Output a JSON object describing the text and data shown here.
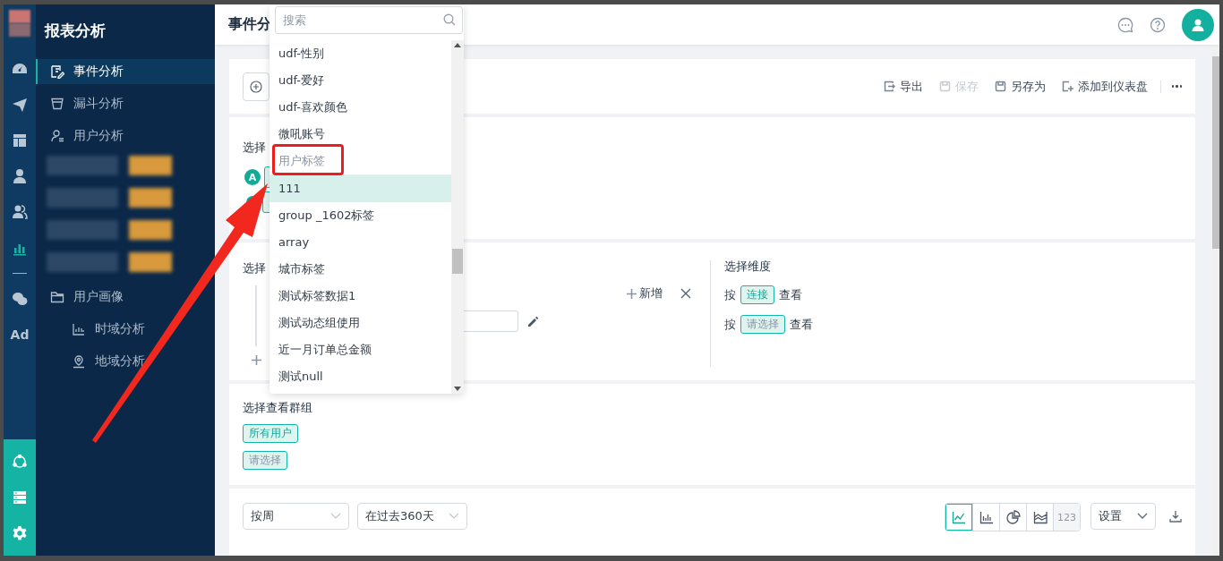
{
  "rail": {
    "items": [
      {
        "selected": false
      },
      {
        "selected": false
      },
      {
        "selected": false
      },
      {
        "selected": false
      },
      {
        "selected": false
      },
      {
        "selected": true
      },
      {
        "selected": false
      }
    ],
    "ad_label": "Ad",
    "bottom_items": [
      {
        "selected": false
      },
      {
        "selected": false
      },
      {
        "selected": false
      }
    ]
  },
  "sidebar": {
    "title": "报表分析",
    "items": [
      {
        "kind": "link",
        "label": "事件分析",
        "selected": true
      },
      {
        "kind": "link",
        "label": "漏斗分析",
        "selected": false
      },
      {
        "kind": "link",
        "label": "用户分析",
        "selected": false
      },
      {
        "kind": "redacted"
      },
      {
        "kind": "redacted"
      },
      {
        "kind": "redacted"
      },
      {
        "kind": "redacted"
      },
      {
        "kind": "folder",
        "label": "用户画像",
        "selected": false,
        "children": [
          {
            "label": "时域分析",
            "selected": false
          },
          {
            "label": "地域分析",
            "selected": false
          }
        ]
      }
    ]
  },
  "header": {
    "title": "事件分"
  },
  "toolbar": {
    "actions": [
      {
        "label": "导出",
        "disabled": false
      },
      {
        "label": "保存",
        "disabled": true
      },
      {
        "label": "另存为",
        "disabled": false
      },
      {
        "label": "添加到仪表盘",
        "disabled": false
      }
    ]
  },
  "events": {
    "label": "选择",
    "badge": "A"
  },
  "metrics": {
    "label": "选择",
    "add_label": "新增"
  },
  "dimensions": {
    "label": "选择维度",
    "rows": [
      {
        "prefix": "按",
        "tag": "连接",
        "placeholder": false,
        "suffix": "查看"
      },
      {
        "prefix": "按",
        "tag": "请选择",
        "placeholder": true,
        "suffix": "查看"
      }
    ]
  },
  "groups": {
    "label": "选择查看群组",
    "tags": [
      {
        "label": "所有用户",
        "placeholder": false
      },
      {
        "label": "请选择",
        "placeholder": true
      }
    ]
  },
  "chart_controls": {
    "interval": "按周",
    "range": "在过去360天",
    "chart_types": [
      {
        "selected": true,
        "disabled": false
      },
      {
        "selected": false,
        "disabled": false
      },
      {
        "selected": false,
        "disabled": false
      },
      {
        "selected": false,
        "disabled": false
      },
      {
        "selected": false,
        "disabled": true,
        "label": "123"
      }
    ],
    "settings": "设置"
  },
  "dropdown": {
    "search": {
      "placeholder": "搜索"
    },
    "items": [
      {
        "kind": "option",
        "label": "udf-性别",
        "selected": false
      },
      {
        "kind": "option",
        "label": "udf-爱好",
        "selected": false
      },
      {
        "kind": "option",
        "label": "udf-喜欢颜色",
        "selected": false
      },
      {
        "kind": "option",
        "label": "微吼账号",
        "selected": false
      },
      {
        "kind": "group",
        "label": "用户标签",
        "highlighted": true
      },
      {
        "kind": "option",
        "label": "111",
        "selected": true
      },
      {
        "kind": "option",
        "label": "group _1602标签",
        "selected": false
      },
      {
        "kind": "option",
        "label": "array",
        "selected": false
      },
      {
        "kind": "option",
        "label": "城市标签",
        "selected": false
      },
      {
        "kind": "option",
        "label": "测试标签数据1",
        "selected": false
      },
      {
        "kind": "option",
        "label": "测试动态组使用",
        "selected": false
      },
      {
        "kind": "option",
        "label": "近一月订单总金额",
        "selected": false
      },
      {
        "kind": "option",
        "label": "测试null",
        "selected": false
      }
    ]
  }
}
